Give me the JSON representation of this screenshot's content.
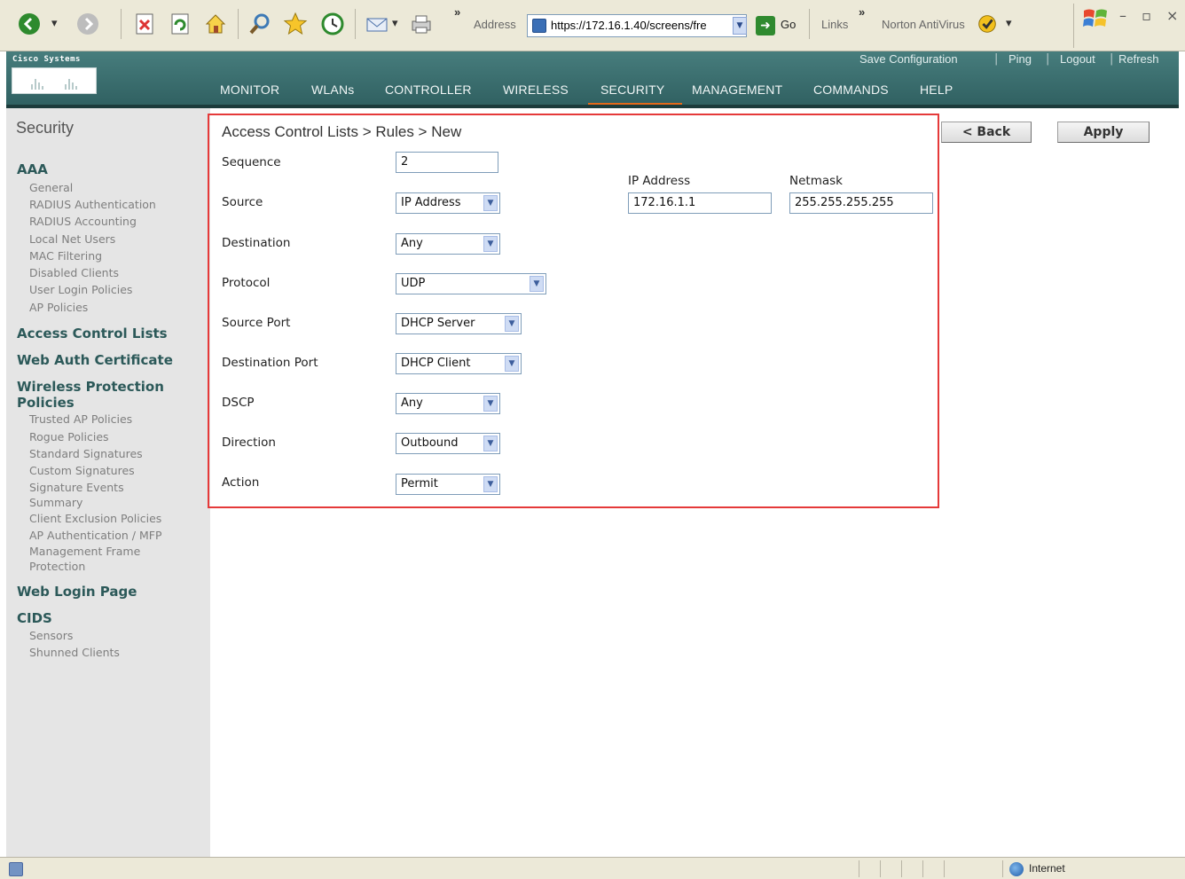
{
  "browser": {
    "address_label": "Address",
    "address_url": "https://172.16.1.40/screens/fre",
    "go_label": "Go",
    "links_label": "Links",
    "norton_label": "Norton AntiVirus",
    "chevron": "»"
  },
  "header": {
    "logo_text": "Cisco Systems",
    "top_links": [
      "Save Configuration",
      "Ping",
      "Logout",
      "Refresh"
    ],
    "nav": [
      "MONITOR",
      "WLANs",
      "CONTROLLER",
      "WIRELESS",
      "SECURITY",
      "MANAGEMENT",
      "COMMANDS",
      "HELP"
    ],
    "active_nav": "SECURITY",
    "accent_color": "#e36a1b"
  },
  "sidebar": {
    "title": "Security",
    "sections": [
      {
        "label": "AAA",
        "items": [
          "General",
          "RADIUS Authentication",
          "RADIUS Accounting",
          "Local Net Users",
          "MAC Filtering",
          "Disabled Clients",
          "User Login Policies",
          "AP Policies"
        ]
      },
      {
        "label": "Access Control Lists",
        "items": []
      },
      {
        "label": "Web Auth Certificate",
        "items": []
      },
      {
        "label": "Wireless Protection",
        "label2": "Policies",
        "items": [
          "Trusted AP Policies",
          "Rogue Policies",
          "Standard Signatures",
          "Custom Signatures",
          "Signature Events",
          "Summary",
          "Client Exclusion Policies",
          "AP Authentication / MFP",
          "Management Frame",
          "Protection"
        ]
      },
      {
        "label": "Web Login Page",
        "items": []
      },
      {
        "label": "CIDS",
        "items": [
          "Sensors",
          "Shunned Clients"
        ]
      }
    ]
  },
  "form": {
    "breadcrumb": "Access Control Lists > Rules > New",
    "back_label": "< Back",
    "apply_label": "Apply",
    "sequence": {
      "label": "Sequence",
      "value": "2"
    },
    "source": {
      "label": "Source",
      "value": "IP Address"
    },
    "destination": {
      "label": "Destination",
      "value": "Any"
    },
    "protocol": {
      "label": "Protocol",
      "value": "UDP"
    },
    "source_port": {
      "label": "Source Port",
      "value": "DHCP Server"
    },
    "destination_port": {
      "label": "Destination Port",
      "value": "DHCP Client"
    },
    "dscp": {
      "label": "DSCP",
      "value": "Any"
    },
    "direction": {
      "label": "Direction",
      "value": "Outbound"
    },
    "action": {
      "label": "Action",
      "value": "Permit"
    },
    "ip_address": {
      "label": "IP Address",
      "value": "172.16.1.1"
    },
    "netmask": {
      "label": "Netmask",
      "value": "255.255.255.255"
    },
    "highlight_color": "#e53a3a"
  },
  "status_bar": {
    "zone": "Internet"
  },
  "icons": [
    "back-icon",
    "forward-icon",
    "stop-icon",
    "refresh-icon",
    "home-icon",
    "search-icon",
    "favorites-icon",
    "history-icon",
    "mail-icon",
    "print-icon",
    "page-icon",
    "go-icon",
    "norton-icon",
    "windows-logo-icon",
    "internet-zone-icon"
  ]
}
